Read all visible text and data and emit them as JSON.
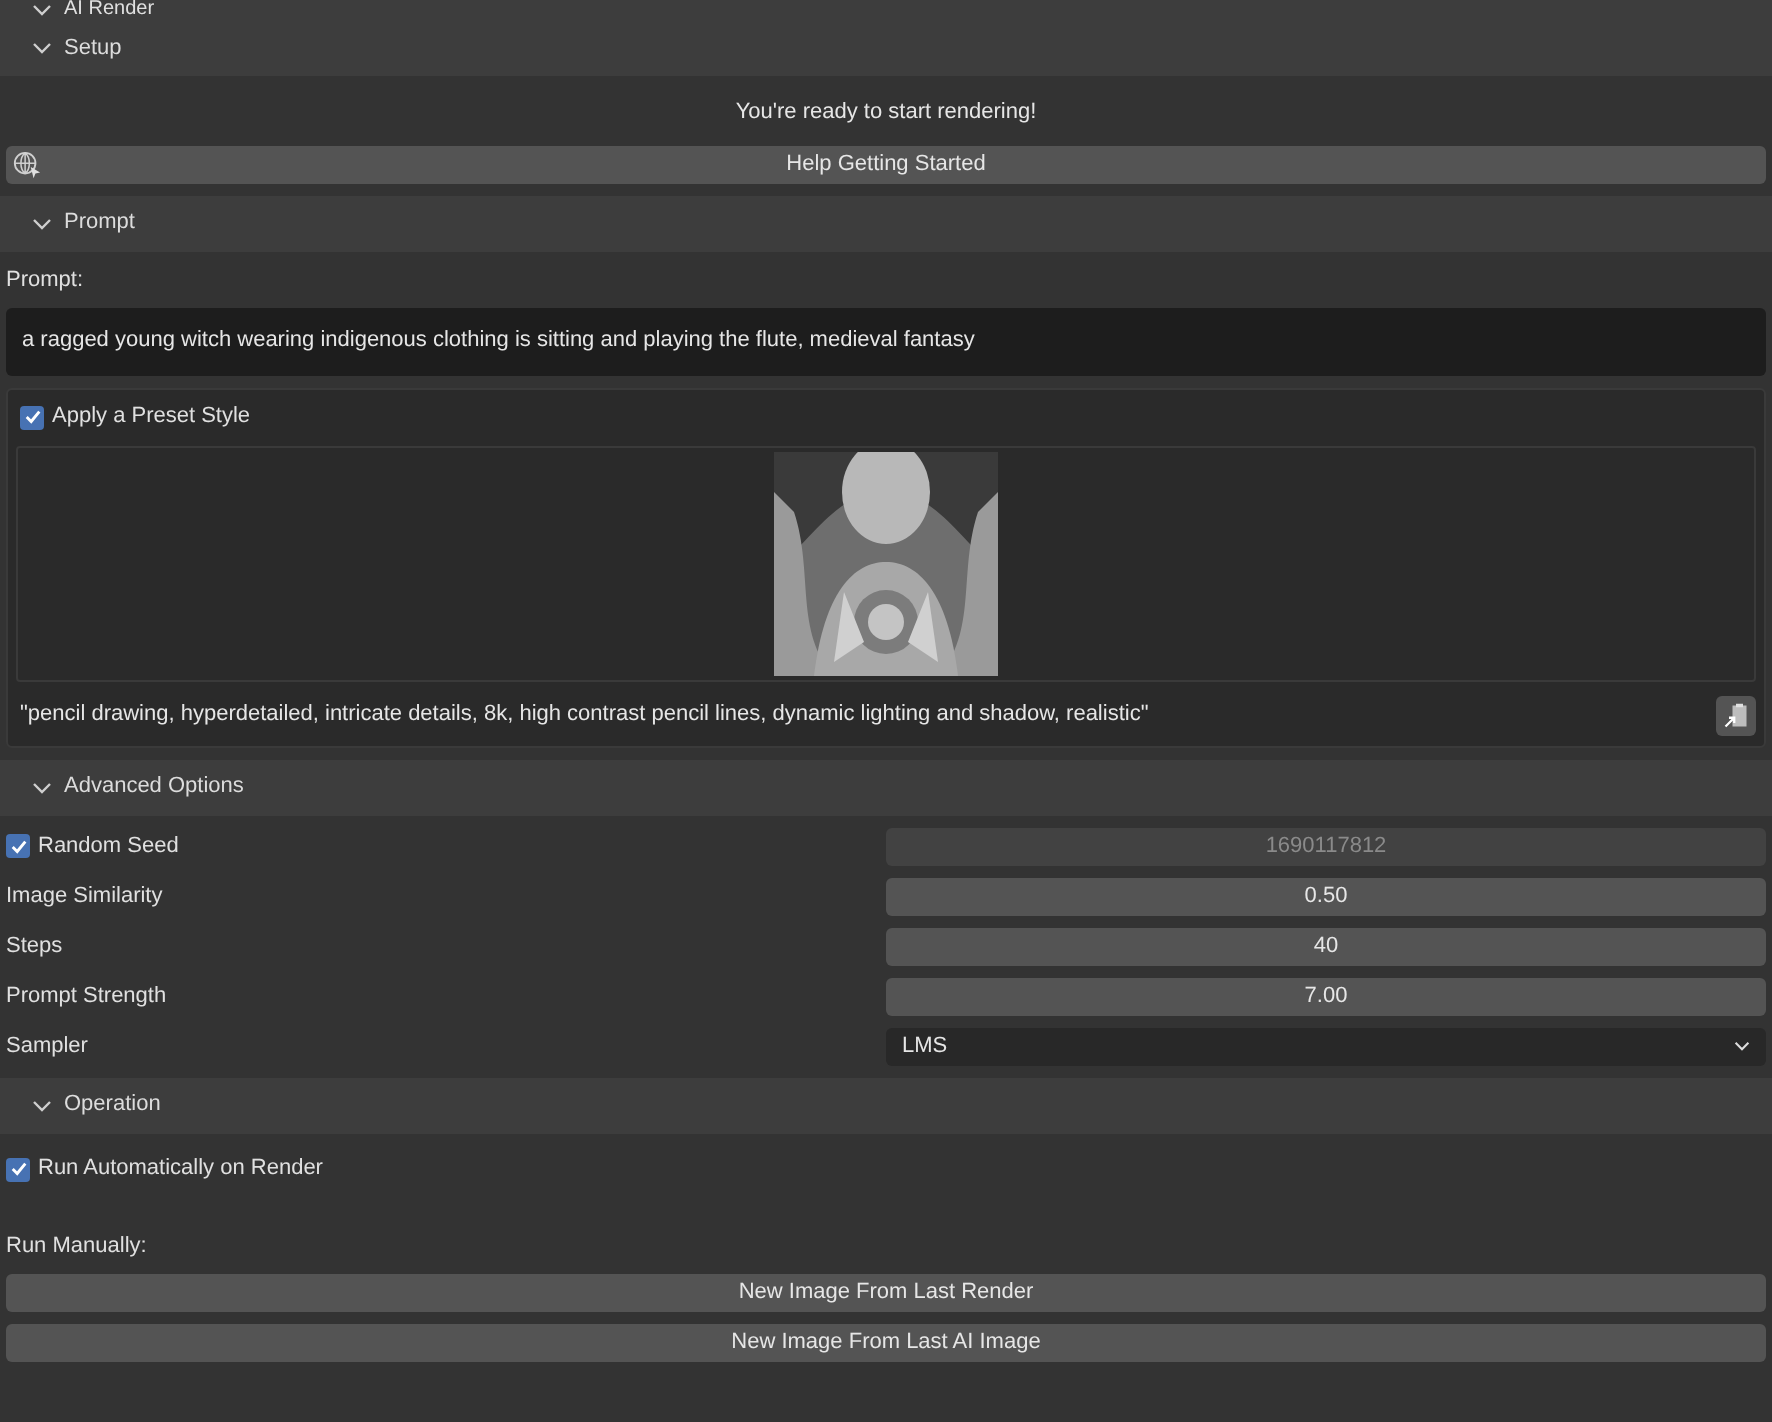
{
  "panel": {
    "title": "AI Render",
    "expanded": true
  },
  "setup": {
    "header": {
      "title": "Setup",
      "expanded": true
    },
    "status": "You're ready to start rendering!",
    "help_button": "Help Getting Started"
  },
  "prompt": {
    "header": {
      "title": "Prompt",
      "expanded": true
    },
    "label": "Prompt:",
    "value": "a ragged young witch wearing indigenous clothing is sitting and playing the flute, medieval fantasy",
    "preset": {
      "label": "Apply a Preset Style",
      "checked": true,
      "style_text": "\"pencil drawing, hyperdetailed, intricate details, 8k, high contrast pencil lines, dynamic lighting and shadow, realistic\""
    }
  },
  "advanced": {
    "header": {
      "title": "Advanced Options",
      "expanded": true
    },
    "rows": [
      {
        "kind": "check-number",
        "label": "Random Seed",
        "checked": true,
        "value": "1690117812",
        "disabled": true
      },
      {
        "kind": "number",
        "label": "Image Similarity",
        "value": "0.50",
        "disabled": false
      },
      {
        "kind": "number",
        "label": "Steps",
        "value": "40",
        "disabled": false
      },
      {
        "kind": "number",
        "label": "Prompt Strength",
        "value": "7.00",
        "disabled": false
      },
      {
        "kind": "dropdown",
        "label": "Sampler",
        "value": "LMS"
      }
    ]
  },
  "operation": {
    "header": {
      "title": "Operation",
      "expanded": true
    },
    "auto": {
      "label": "Run Automatically on Render",
      "checked": true
    },
    "manual_label": "Run Manually:",
    "buttons": [
      "New Image From Last Render",
      "New Image From Last AI Image"
    ]
  }
}
